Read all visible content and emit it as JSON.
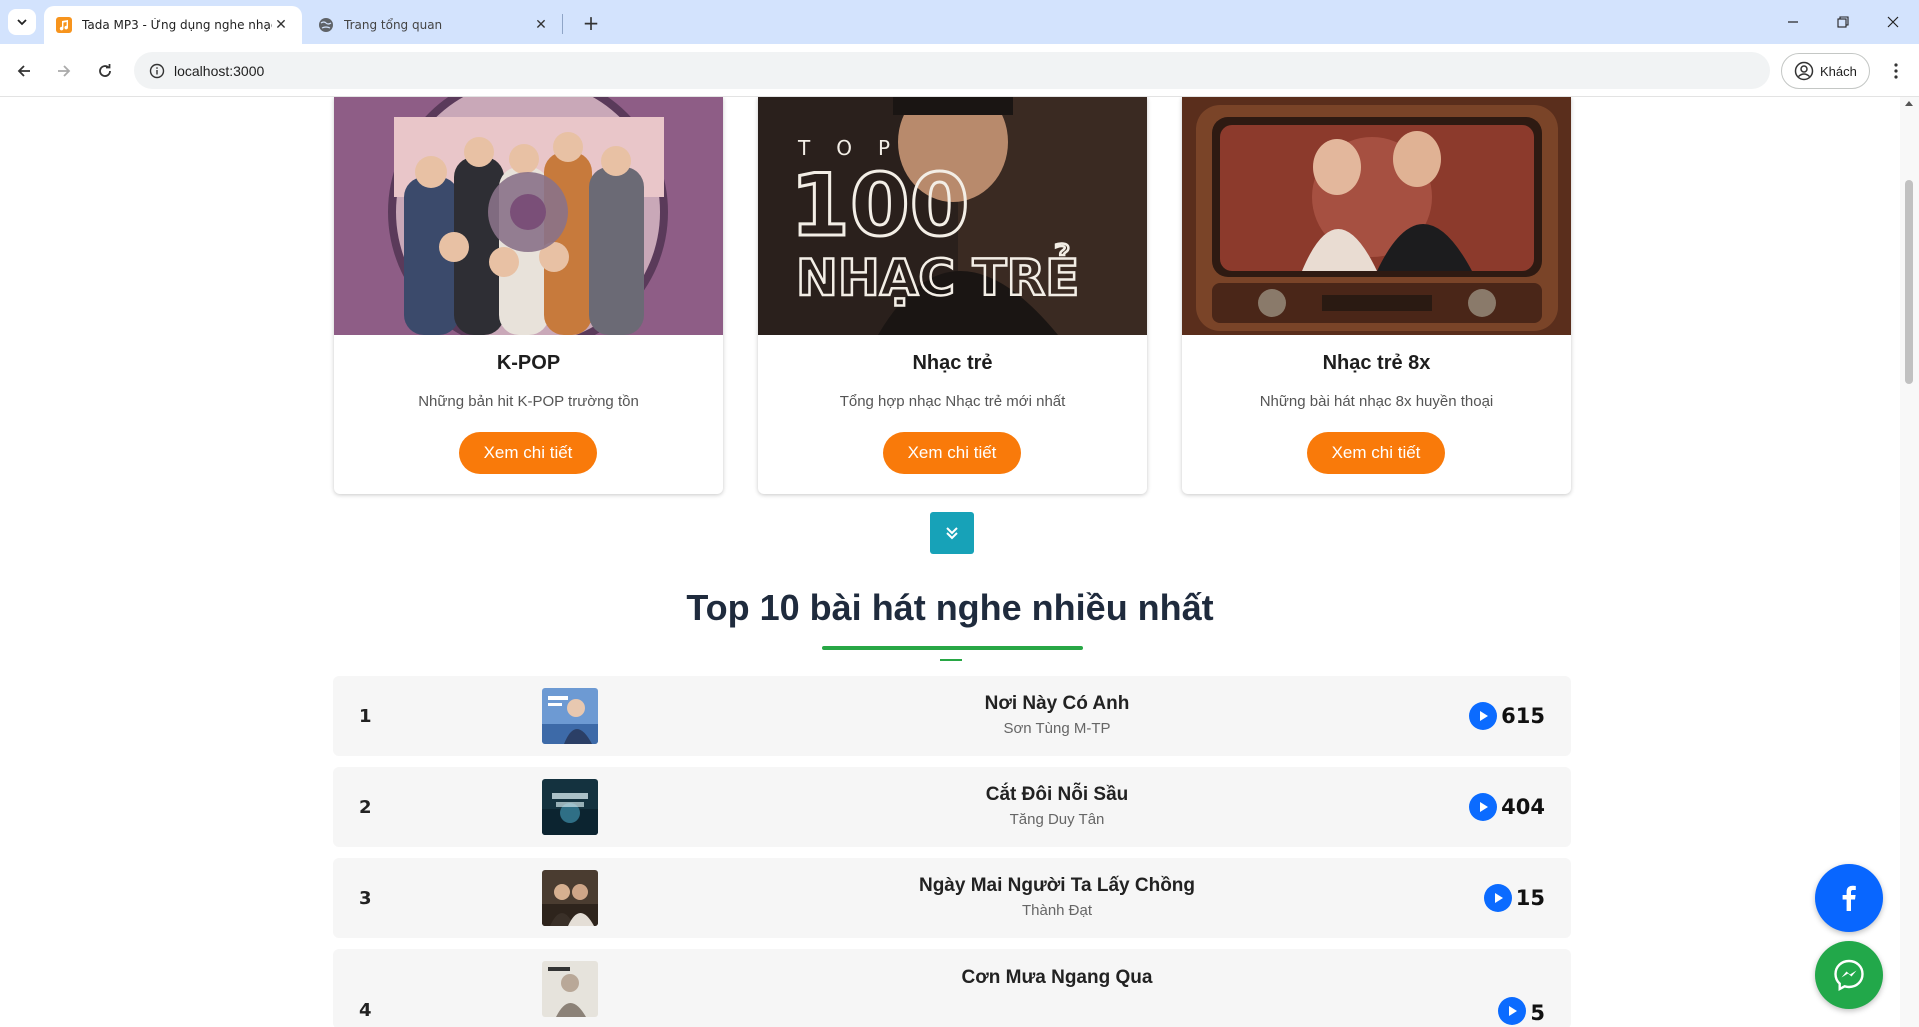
{
  "browser": {
    "tabs": [
      {
        "title": "Tada MP3 - Ứng dụng nghe nhạc trực tuyến",
        "active": true
      },
      {
        "title": "Trang tổng quan",
        "active": false
      }
    ],
    "url": "localhost:3000",
    "profile_label": "Khách"
  },
  "playlists": [
    {
      "title": "K-POP",
      "description": "Những bản hit K-POP trường tồn",
      "button": "Xem chi tiết"
    },
    {
      "title": "Nhạc trẻ",
      "description": "Tổng hợp nhạc Nhạc trẻ mới nhất",
      "button": "Xem chi tiết",
      "cover_text_top": "TOP",
      "cover_text_number": "100",
      "cover_text_bottom": "NHẠC TRẺ"
    },
    {
      "title": "Nhạc trẻ 8x",
      "description": "Những bài hát nhạc 8x huyền thoại",
      "button": "Xem chi tiết"
    }
  ],
  "top_songs": {
    "heading": "Top 10 bài hát nghe nhiều nhất",
    "items": [
      {
        "rank": "1",
        "name": "Nơi Này Có Anh",
        "artist": "Sơn Tùng M-TP",
        "plays": "615"
      },
      {
        "rank": "2",
        "name": "Cắt Đôi Nỗi Sầu",
        "artist": "Tăng Duy Tân",
        "plays": "404"
      },
      {
        "rank": "3",
        "name": "Ngày Mai Người Ta Lấy Chồng",
        "artist": "Thành Đạt",
        "plays": "15"
      },
      {
        "rank": "4",
        "name": "Cơn Mưa Ngang Qua",
        "artist": "",
        "plays": "5"
      }
    ]
  },
  "colors": {
    "accent_orange": "#f97a0a",
    "expand_button": "#17a2b8",
    "underline_green": "#28a745",
    "play_blue": "#0b6bff",
    "facebook_blue": "#0866ff",
    "messenger_green": "#22a84a"
  },
  "icons": {
    "tab_menu": "chevron-down-icon",
    "tab_favicon": "music-note-icon",
    "back": "arrow-left-icon",
    "forward": "arrow-right-icon",
    "reload": "reload-icon",
    "site_info": "info-icon",
    "profile": "account-circle-icon",
    "menu": "kebab-icon",
    "expand": "double-chevron-down-icon",
    "play": "play-circle-icon",
    "facebook": "facebook-icon",
    "messenger": "messenger-icon"
  }
}
